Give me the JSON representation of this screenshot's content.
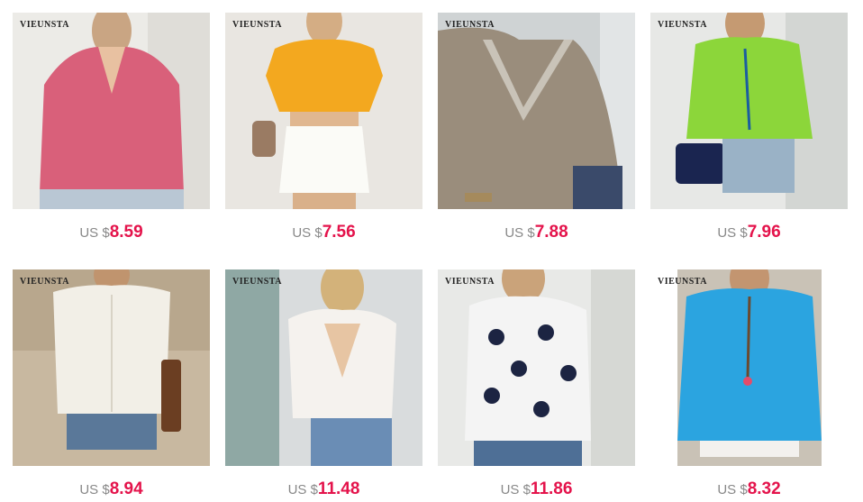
{
  "products": [
    {
      "brand": "VIEUNSTA",
      "currency": "US $",
      "price": "8.59",
      "color": "#d9607a"
    },
    {
      "brand": "VIEUNSTA",
      "currency": "US $",
      "price": "7.56",
      "color": "#f3a81f"
    },
    {
      "brand": "VIEUNSTA",
      "currency": "US $",
      "price": "7.88",
      "color": "#9a8d7c"
    },
    {
      "brand": "VIEUNSTA",
      "currency": "US $",
      "price": "7.96",
      "color": "#8cd63a"
    },
    {
      "brand": "VIEUNSTA",
      "currency": "US $",
      "price": "8.94",
      "color": "#f2efe7"
    },
    {
      "brand": "VIEUNSTA",
      "currency": "US $",
      "price": "11.48",
      "color": "#f5f2ee"
    },
    {
      "brand": "VIEUNSTA",
      "currency": "US $",
      "price": "11.86",
      "color": "#f4f4f4"
    },
    {
      "brand": "VIEUNSTA",
      "currency": "US $",
      "price": "8.32",
      "color": "#2ba4e0"
    }
  ],
  "colors": {
    "price": "#e4134b",
    "currency": "#888888"
  }
}
